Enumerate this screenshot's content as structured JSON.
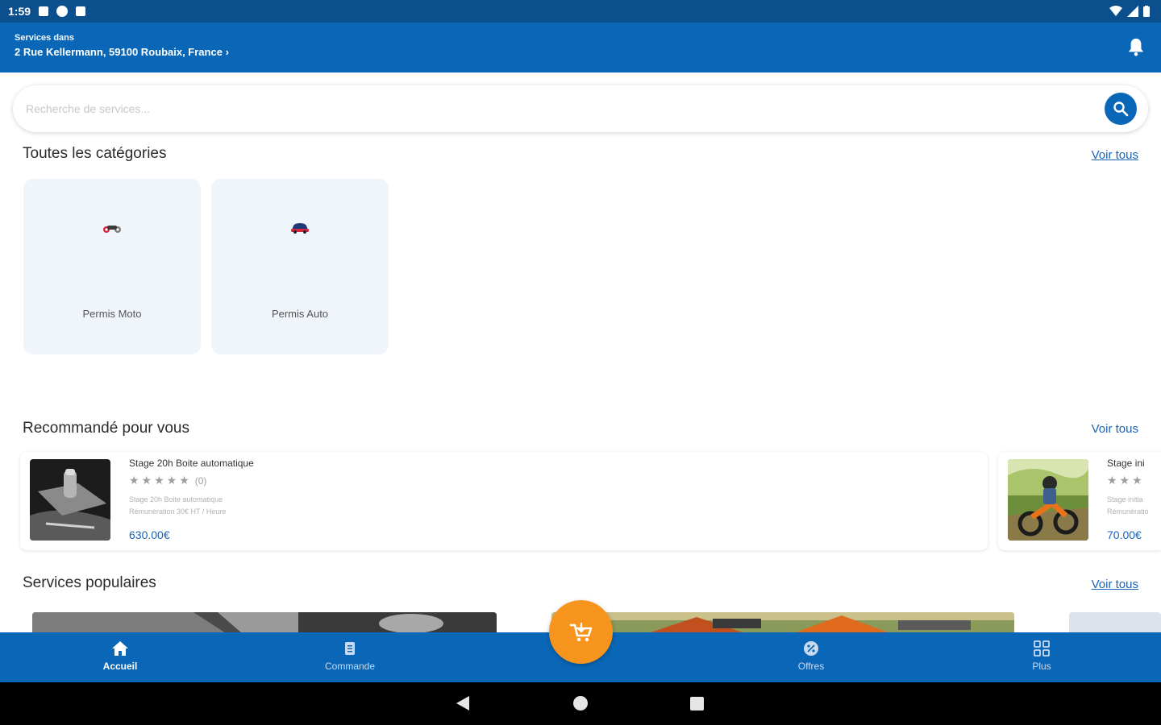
{
  "status_bar": {
    "time": "1:59"
  },
  "header": {
    "services_label": "Services dans",
    "address": "2 Rue Kellermann, 59100 Roubaix, France",
    "address_chevron": "›"
  },
  "search": {
    "placeholder": "Recherche de services..."
  },
  "categories": {
    "title": "Toutes les catégories",
    "see_all": "Voir tous",
    "items": [
      {
        "label": "Permis Moto",
        "icon": "motorcycle-icon"
      },
      {
        "label": "Permis Auto",
        "icon": "car-icon"
      }
    ]
  },
  "recommended": {
    "title": "Recommandé pour vous",
    "see_all": "Voir tous",
    "items": [
      {
        "title": "Stage 20h Boite automatique",
        "stars": "★★★★★",
        "rating_count": "(0)",
        "desc_line1": "Stage 20h Boite automatique",
        "desc_line2": "Rémunération 30€ HT / Heure",
        "price": "630.00€"
      },
      {
        "title": "Stage ini",
        "stars": "★★★",
        "rating_count": "",
        "desc_line1": "Stage initia",
        "desc_line2": "Rémunératio",
        "price": "70.00€"
      }
    ]
  },
  "popular": {
    "title": "Services populaires",
    "see_all": "Voir tous"
  },
  "bottom_nav": {
    "items": [
      {
        "label": "Accueil",
        "icon": "home-icon",
        "active": true
      },
      {
        "label": "Commande",
        "icon": "clipboard-icon",
        "active": false
      },
      {
        "label": "Offres",
        "icon": "offer-icon",
        "active": false
      },
      {
        "label": "Plus",
        "icon": "grid-icon",
        "active": false
      }
    ],
    "fab_icon": "cart-icon"
  },
  "colors": {
    "primary": "#0a67b8",
    "status_bar": "#0b4f8c",
    "accent": "#f7941d",
    "card_bg": "#f0f5fc",
    "link": "#1a63b5"
  }
}
